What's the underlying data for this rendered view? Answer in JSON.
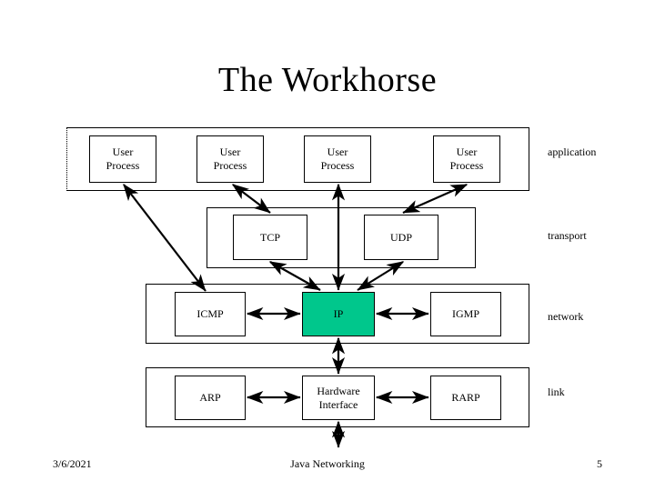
{
  "slide": {
    "title": "The Workhorse",
    "accent_color": "#00c78c",
    "line_color": "#000000",
    "background_color": "#ffffff"
  },
  "layers": [
    {
      "id": "application",
      "name": "application",
      "boxes": [
        {
          "id": "user-process-1",
          "label": "User\nProcess"
        },
        {
          "id": "user-process-2",
          "label": "User\nProcess"
        },
        {
          "id": "user-process-3",
          "label": "User\nProcess"
        },
        {
          "id": "user-process-4",
          "label": "User\nProcess"
        }
      ]
    },
    {
      "id": "transport",
      "name": "transport",
      "boxes": [
        {
          "id": "tcp",
          "label": "TCP"
        },
        {
          "id": "udp",
          "label": "UDP"
        }
      ]
    },
    {
      "id": "network",
      "name": "network",
      "boxes": [
        {
          "id": "icmp",
          "label": "ICMP"
        },
        {
          "id": "ip",
          "label": "IP",
          "highlighted": true
        },
        {
          "id": "igmp",
          "label": "IGMP"
        }
      ]
    },
    {
      "id": "link",
      "name": "link",
      "boxes": [
        {
          "id": "arp",
          "label": "ARP"
        },
        {
          "id": "hardware-interface",
          "label": "Hardware\nInterface"
        },
        {
          "id": "rarp",
          "label": "RARP"
        }
      ]
    }
  ],
  "box_labels": {
    "user_process_1": "User\nProcess",
    "user_process_2": "User\nProcess",
    "user_process_3": "User\nProcess",
    "user_process_4": "User\nProcess",
    "tcp": "TCP",
    "udp": "UDP",
    "icmp": "ICMP",
    "ip": "IP",
    "igmp": "IGMP",
    "arp": "ARP",
    "hardware_interface": "Hardware\nInterface",
    "rarp": "RARP"
  },
  "layer_names": {
    "application": "application",
    "transport": "transport",
    "network": "network",
    "link": "link"
  },
  "footer": {
    "date": "3/6/2021",
    "center": "Java Networking",
    "page_number": "5"
  }
}
